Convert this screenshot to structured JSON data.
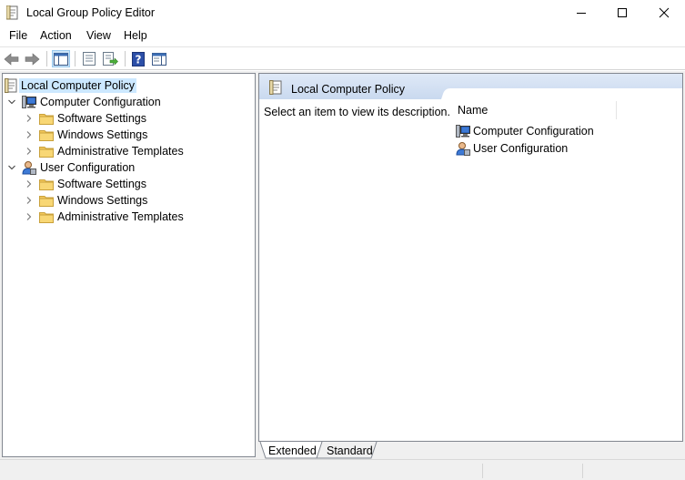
{
  "window": {
    "title": "Local Group Policy Editor"
  },
  "menu": {
    "items": [
      {
        "label": "File"
      },
      {
        "label": "Action"
      },
      {
        "label": "View"
      },
      {
        "label": "Help"
      }
    ]
  },
  "toolbar": {
    "buttons": [
      "back-arrow-icon",
      "forward-arrow-icon",
      "show-hide-console-tree-icon",
      "properties-icon",
      "export-list-icon",
      "help-icon",
      "show-hide-action-pane-icon"
    ]
  },
  "tree": {
    "root": "Local Computer Policy",
    "computer_config": "Computer Configuration",
    "user_config": "User Configuration",
    "computer_children": [
      "Software Settings",
      "Windows Settings",
      "Administrative Templates"
    ],
    "user_children": [
      "Software Settings",
      "Windows Settings",
      "Administrative Templates"
    ]
  },
  "right": {
    "title": "Local Computer Policy",
    "description": "Select an item to view its description.",
    "column_name": "Name",
    "items": [
      "Computer Configuration",
      "User Configuration"
    ]
  },
  "tabs": {
    "extended": "Extended",
    "standard": "Standard"
  },
  "colors": {
    "selection": "#cce8ff",
    "header_blue": "#d6e3f5",
    "folder": "#f4c95d"
  }
}
